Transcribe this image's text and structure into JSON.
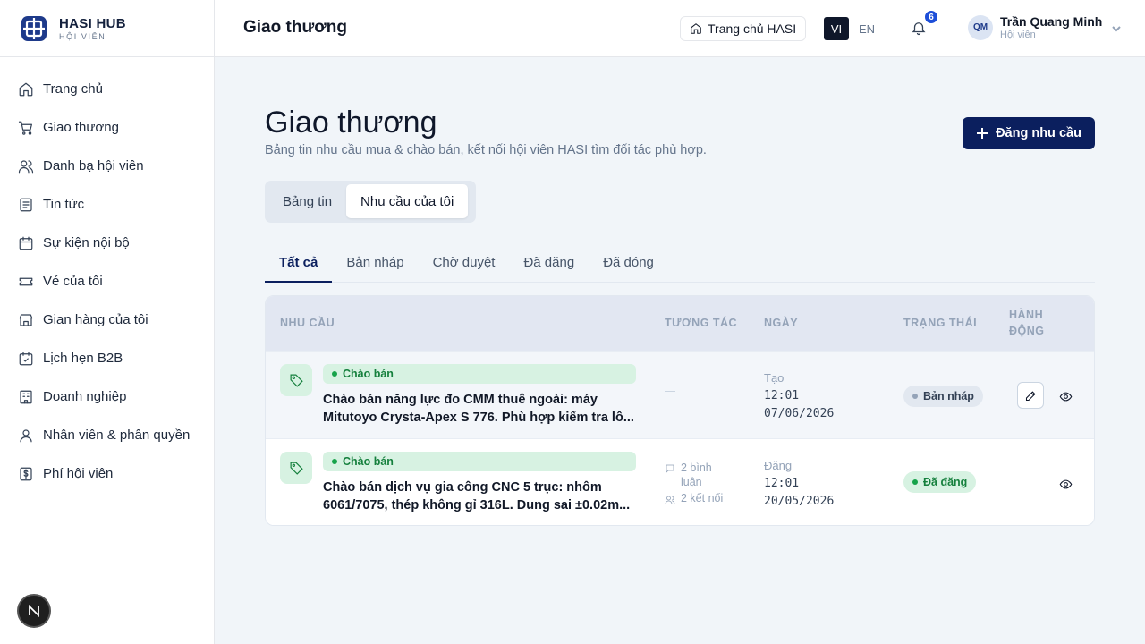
{
  "brand": {
    "name": "HASI HUB",
    "sub": "HỘI VIÊN"
  },
  "sidebar": {
    "items": [
      {
        "label": "Trang chủ",
        "icon": "home-icon"
      },
      {
        "label": "Giao thương",
        "icon": "cart-icon"
      },
      {
        "label": "Danh bạ hội viên",
        "icon": "users-icon"
      },
      {
        "label": "Tin tức",
        "icon": "news-icon"
      },
      {
        "label": "Sự kiện nội bộ",
        "icon": "calendar-icon"
      },
      {
        "label": "Vé của tôi",
        "icon": "ticket-icon"
      },
      {
        "label": "Gian hàng của tôi",
        "icon": "store-icon"
      },
      {
        "label": "Lịch hẹn B2B",
        "icon": "calendar-check-icon"
      },
      {
        "label": "Doanh nghiệp",
        "icon": "building-icon"
      },
      {
        "label": "Nhân viên & phân quyền",
        "icon": "user-icon"
      },
      {
        "label": "Phí hội viên",
        "icon": "dollar-icon"
      }
    ]
  },
  "header": {
    "title": "Giao thương",
    "home_button": "Trang chủ HASI",
    "lang_vi": "VI",
    "lang_en": "EN",
    "notification_count": "6",
    "user": {
      "initials": "QM",
      "name": "Trần Quang Minh",
      "role": "Hội viên"
    }
  },
  "main": {
    "title": "Giao thương",
    "subtitle": "Bảng tin nhu cầu mua & chào bán, kết nối hội viên HASI tìm đối tác phù hợp.",
    "post_button": "Đăng nhu cầu",
    "segments": [
      "Bảng tin",
      "Nhu cầu của tôi"
    ],
    "active_segment": 1,
    "tabs": [
      "Tất cả",
      "Bản nháp",
      "Chờ duyệt",
      "Đã đăng",
      "Đã đóng"
    ],
    "active_tab": 0,
    "table": {
      "headers": {
        "need": "NHU CẦU",
        "interaction": "TƯƠNG TÁC",
        "date": "NGÀY",
        "status": "TRẠNG THÁI",
        "action_line1": "HÀNH",
        "action_line2": "ĐỘNG"
      },
      "rows": [
        {
          "type": "Chào bán",
          "title": "Chào bán năng lực đo CMM thuê ngoài: máy Mitutoyo Crysta-Apex S 776. Phù hợp kiểm tra lô...",
          "interaction": "—",
          "date_label": "Tạo",
          "time": "12:01",
          "date": "07/06/2026",
          "status": "Bản nháp"
        },
        {
          "type": "Chào bán",
          "title": "Chào bán dịch vụ gia công CNC 5 trục: nhôm 6061/7075, thép không gỉ 316L. Dung sai ±0.02m...",
          "comments": "2 bình luận",
          "connections": "2 kết nối",
          "date_label": "Đăng",
          "time": "12:01",
          "date": "20/05/2026",
          "status": "Đã đăng"
        }
      ]
    }
  },
  "colors": {
    "primary": "#0b1f5e",
    "success": "#15803d",
    "success_bg": "#d7f2e2",
    "badge": "#1d4ed8"
  }
}
